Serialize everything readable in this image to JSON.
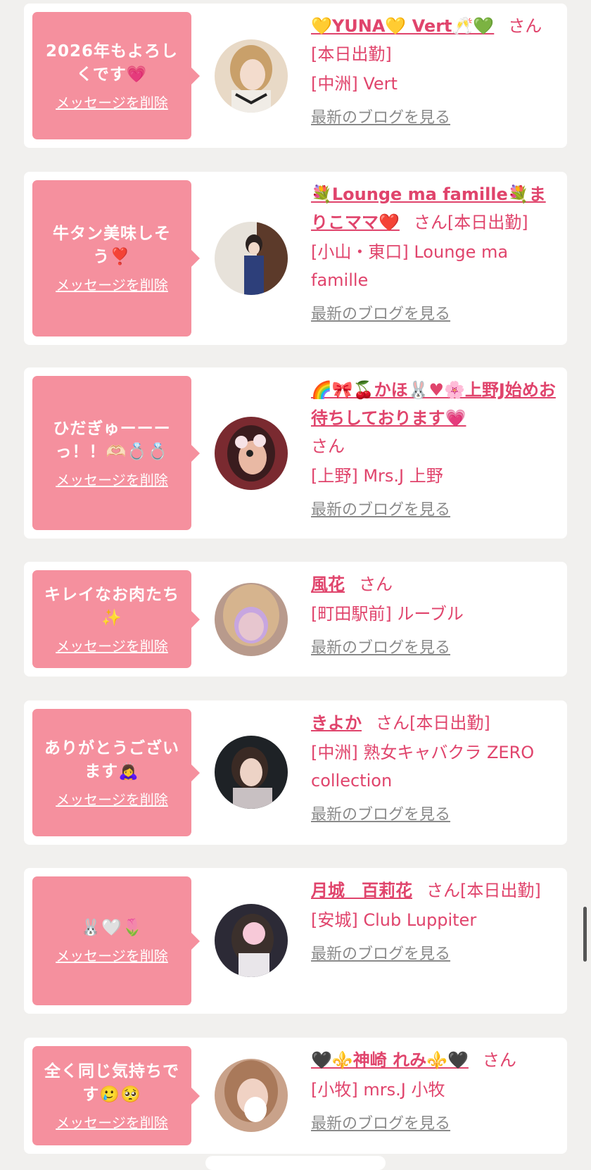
{
  "colors": {
    "background": "#f1f0ee",
    "bubble": "#f5909e",
    "accent": "#e0446c",
    "link_gray": "#8a8a8a"
  },
  "cards": [
    {
      "message": "2026年もよろしくです💗",
      "delete_label": "メッセージを削除",
      "name": "💛YUNA💛 Vert🥂💚",
      "honorific": "さん",
      "working": "[本日出勤]",
      "shop": "[中洲] Vert",
      "blog_label": "最新のブログを見る",
      "avatar": "profile-photo-1"
    },
    {
      "message": "牛タン美味しそう❣️",
      "delete_label": "メッセージを削除",
      "name": "💐Lounge ma famille💐まりこママ❤️",
      "honorific": "さん",
      "working": "[本日出勤]",
      "shop": "[小山・東口] Lounge ma famille",
      "blog_label": "最新のブログを見る",
      "avatar": "profile-photo-2"
    },
    {
      "message": "ひだぎゅーーーっ！！🫶🏻💍💍",
      "delete_label": "メッセージを削除",
      "name": "🌈🎀🍒かほ🐰♥🌸上野J始めお待ちしております💗",
      "honorific": "さん",
      "working": "",
      "shop": "[上野] Mrs.J 上野",
      "blog_label": "最新のブログを見る",
      "avatar": "profile-photo-3"
    },
    {
      "message": "キレイなお肉たち✨",
      "delete_label": "メッセージを削除",
      "name": "風花",
      "honorific": "さん",
      "working": "",
      "shop": "[町田駅前] ルーブル",
      "blog_label": "最新のブログを見る",
      "avatar": "profile-photo-4"
    },
    {
      "message": "ありがとうございます🙇‍♀️",
      "delete_label": "メッセージを削除",
      "name": "きよか",
      "honorific": "さん",
      "working": "[本日出勤]",
      "shop": "[中洲] 熟女キャバクラ ZERO collection",
      "blog_label": "最新のブログを見る",
      "avatar": "profile-photo-5"
    },
    {
      "message": "🐰🤍🌷",
      "delete_label": "メッセージを削除",
      "name": "月城　百莉花",
      "honorific": "さん",
      "working": "[本日出勤]",
      "shop": "[安城] Club Luppiter",
      "blog_label": "最新のブログを見る",
      "avatar": "profile-photo-6"
    },
    {
      "message": "全く同じ気持ちです🥲🥺",
      "delete_label": "メッセージを削除",
      "name": "🖤⚜️神崎 れみ⚜️🖤",
      "honorific": "さん",
      "working": "",
      "shop": "[小牧] mrs.J 小牧",
      "blog_label": "最新のブログを見る",
      "avatar": "profile-photo-7"
    }
  ]
}
